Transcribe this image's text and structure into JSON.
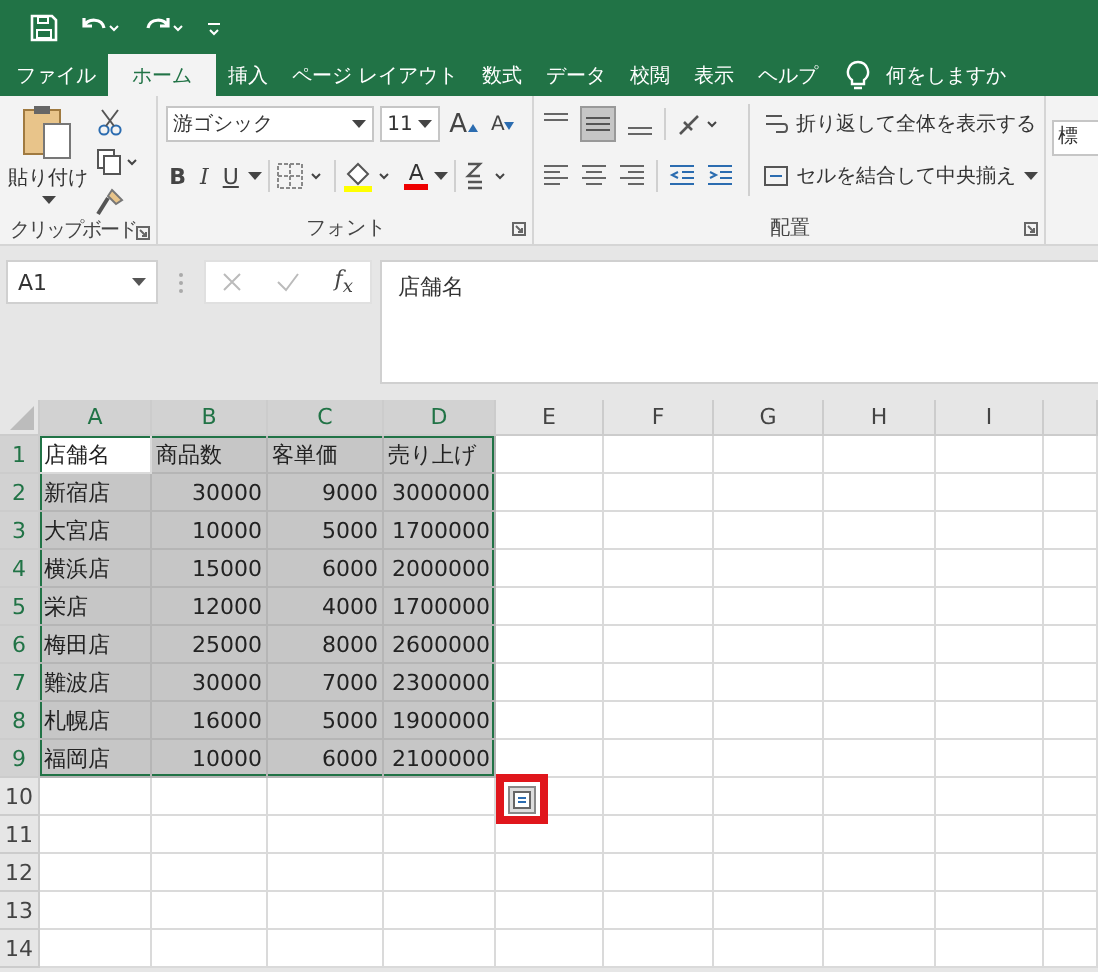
{
  "tabs": [
    {
      "label": "ファイル",
      "selected": false
    },
    {
      "label": "ホーム",
      "selected": true
    },
    {
      "label": "挿入",
      "selected": false
    },
    {
      "label": "ページ レイアウト",
      "selected": false
    },
    {
      "label": "数式",
      "selected": false
    },
    {
      "label": "データ",
      "selected": false
    },
    {
      "label": "校閲",
      "selected": false
    },
    {
      "label": "表示",
      "selected": false
    },
    {
      "label": "ヘルプ",
      "selected": false
    }
  ],
  "search": {
    "placeholder": "何をしますか"
  },
  "ribbon": {
    "clipboard": {
      "paste": "貼り付け",
      "label": "クリップボード"
    },
    "font": {
      "font_name": "游ゴシック",
      "font_size": "11",
      "grow": "A",
      "shrink": "A",
      "bold": "B",
      "italic": "I",
      "underline": "U",
      "font_color": "A",
      "label": "フォント"
    },
    "alignment": {
      "wrap_text": "折り返して全体を表示する",
      "merge_center": "セルを結合して中央揃え",
      "label": "配置"
    },
    "number_format": {
      "value": "標"
    }
  },
  "formula_bar": {
    "name_box": "A1",
    "function_label": "f$_{x}$",
    "formula": "店舗名"
  },
  "sheet": {
    "columns": [
      {
        "label": "A",
        "selected": true
      },
      {
        "label": "B",
        "selected": true
      },
      {
        "label": "C",
        "selected": true
      },
      {
        "label": "D",
        "selected": true
      },
      {
        "label": "E",
        "selected": false
      },
      {
        "label": "F",
        "selected": false
      },
      {
        "label": "G",
        "selected": false
      },
      {
        "label": "H",
        "selected": false
      },
      {
        "label": "I",
        "selected": false
      }
    ],
    "rows": [
      {
        "label": "1",
        "selected": true,
        "cells": [
          {
            "text": "店舗名",
            "kind": "text",
            "selected": false
          },
          {
            "text": "商品数",
            "kind": "text",
            "selected": true
          },
          {
            "text": "客単価",
            "kind": "text",
            "selected": true
          },
          {
            "text": "売り上げ",
            "kind": "text",
            "selected": true
          }
        ]
      },
      {
        "label": "2",
        "selected": true,
        "cells": [
          {
            "text": "新宿店",
            "kind": "text",
            "selected": true
          },
          {
            "text": "30000",
            "kind": "number",
            "selected": true
          },
          {
            "text": "9000",
            "kind": "number",
            "selected": true
          },
          {
            "text": "3000000",
            "kind": "number",
            "selected": true
          }
        ]
      },
      {
        "label": "3",
        "selected": true,
        "cells": [
          {
            "text": "大宮店",
            "kind": "text",
            "selected": true
          },
          {
            "text": "10000",
            "kind": "number",
            "selected": true
          },
          {
            "text": "5000",
            "kind": "number",
            "selected": true
          },
          {
            "text": "1700000",
            "kind": "number",
            "selected": true
          }
        ]
      },
      {
        "label": "4",
        "selected": true,
        "cells": [
          {
            "text": "横浜店",
            "kind": "text",
            "selected": true
          },
          {
            "text": "15000",
            "kind": "number",
            "selected": true
          },
          {
            "text": "6000",
            "kind": "number",
            "selected": true
          },
          {
            "text": "2000000",
            "kind": "number",
            "selected": true
          }
        ]
      },
      {
        "label": "5",
        "selected": true,
        "cells": [
          {
            "text": "栄店",
            "kind": "text",
            "selected": true
          },
          {
            "text": "12000",
            "kind": "number",
            "selected": true
          },
          {
            "text": "4000",
            "kind": "number",
            "selected": true
          },
          {
            "text": "1700000",
            "kind": "number",
            "selected": true
          }
        ]
      },
      {
        "label": "6",
        "selected": true,
        "cells": [
          {
            "text": "梅田店",
            "kind": "text",
            "selected": true
          },
          {
            "text": "25000",
            "kind": "number",
            "selected": true
          },
          {
            "text": "8000",
            "kind": "number",
            "selected": true
          },
          {
            "text": "2600000",
            "kind": "number",
            "selected": true
          }
        ]
      },
      {
        "label": "7",
        "selected": true,
        "cells": [
          {
            "text": "難波店",
            "kind": "text",
            "selected": true
          },
          {
            "text": "30000",
            "kind": "number",
            "selected": true
          },
          {
            "text": "7000",
            "kind": "number",
            "selected": true
          },
          {
            "text": "2300000",
            "kind": "number",
            "selected": true
          }
        ]
      },
      {
        "label": "8",
        "selected": true,
        "cells": [
          {
            "text": "札幌店",
            "kind": "text",
            "selected": true
          },
          {
            "text": "16000",
            "kind": "number",
            "selected": true
          },
          {
            "text": "5000",
            "kind": "number",
            "selected": true
          },
          {
            "text": "1900000",
            "kind": "number",
            "selected": true
          }
        ]
      },
      {
        "label": "9",
        "selected": true,
        "cells": [
          {
            "text": "福岡店",
            "kind": "text",
            "selected": true
          },
          {
            "text": "10000",
            "kind": "number",
            "selected": true
          },
          {
            "text": "6000",
            "kind": "number",
            "selected": true
          },
          {
            "text": "2100000",
            "kind": "number",
            "selected": true
          }
        ]
      },
      {
        "label": "10",
        "selected": false
      },
      {
        "label": "11",
        "selected": false
      },
      {
        "label": "12",
        "selected": false
      },
      {
        "label": "13",
        "selected": false
      },
      {
        "label": "14",
        "selected": false
      }
    ]
  },
  "quick_analysis": {
    "highlighted": true
  }
}
